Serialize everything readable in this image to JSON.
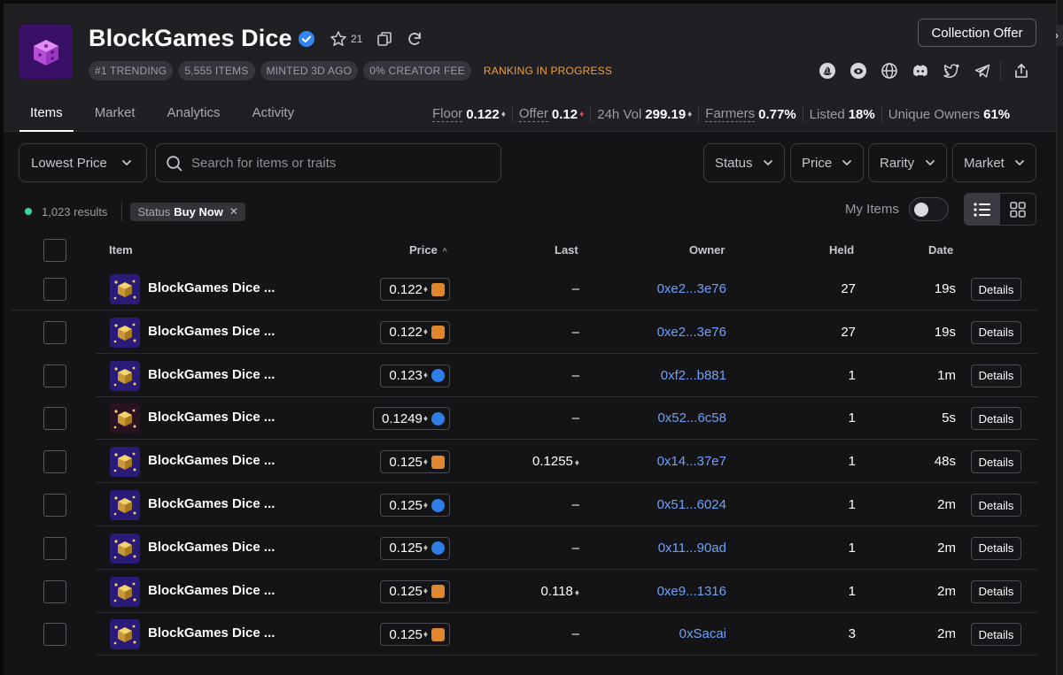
{
  "collection": {
    "title": "BlockGames Dice",
    "watch_count": "21",
    "tags": [
      "#1 TRENDING",
      "5,555 ITEMS",
      "MINTED 3D AGO",
      "0% CREATOR FEE"
    ],
    "ranking": "RANKING IN PROGRESS",
    "offer_button": "Collection Offer"
  },
  "tabs": [
    {
      "label": "Items",
      "active": true
    },
    {
      "label": "Market",
      "active": false
    },
    {
      "label": "Analytics",
      "active": false
    },
    {
      "label": "Activity",
      "active": false
    }
  ],
  "stats": {
    "floor_label": "Floor",
    "floor_value": "0.122",
    "offer_label": "Offer",
    "offer_value": "0.12",
    "vol_label": "24h Vol",
    "vol_value": "299.19",
    "farmers_label": "Farmers",
    "farmers_value": "0.77%",
    "listed_label": "Listed",
    "listed_value": "18%",
    "owners_label": "Unique Owners",
    "owners_value": "61%"
  },
  "toolbar": {
    "sort_label": "Lowest Price",
    "search_placeholder": "Search for items or traits",
    "filters": [
      "Status",
      "Price",
      "Rarity",
      "Market"
    ]
  },
  "results": {
    "count": "1,023 results",
    "chip_label": "Status",
    "chip_value": "Buy Now",
    "my_items_label": "My Items"
  },
  "table": {
    "headers": {
      "item": "Item",
      "price": "Price",
      "last": "Last",
      "owner": "Owner",
      "held": "Held",
      "date": "Date"
    },
    "details_label": "Details",
    "rows": [
      {
        "name": "BlockGames Dice ...",
        "price": "0.122",
        "market": "blur",
        "last": "–",
        "owner": "0xe2...3e76",
        "held": "27",
        "date": "19s"
      },
      {
        "name": "BlockGames Dice ...",
        "price": "0.122",
        "market": "blur",
        "last": "–",
        "owner": "0xe2...3e76",
        "held": "27",
        "date": "19s"
      },
      {
        "name": "BlockGames Dice ...",
        "price": "0.123",
        "market": "opensea",
        "last": "–",
        "owner": "0xf2...b881",
        "held": "1",
        "date": "1m"
      },
      {
        "name": "BlockGames Dice ...",
        "price": "0.1249",
        "market": "opensea",
        "last": "–",
        "owner": "0x52...6c58",
        "held": "1",
        "date": "5s"
      },
      {
        "name": "BlockGames Dice ...",
        "price": "0.125",
        "market": "blur",
        "last": "0.1255",
        "owner": "0x14...37e7",
        "held": "1",
        "date": "48s"
      },
      {
        "name": "BlockGames Dice ...",
        "price": "0.125",
        "market": "opensea",
        "last": "–",
        "owner": "0x51...6024",
        "held": "1",
        "date": "2m"
      },
      {
        "name": "BlockGames Dice ...",
        "price": "0.125",
        "market": "opensea",
        "last": "–",
        "owner": "0x11...90ad",
        "held": "1",
        "date": "2m"
      },
      {
        "name": "BlockGames Dice ...",
        "price": "0.125",
        "market": "blur",
        "last": "0.118",
        "owner": "0xe9...1316",
        "held": "1",
        "date": "2m"
      },
      {
        "name": "BlockGames Dice ...",
        "price": "0.125",
        "market": "blur",
        "last": "–",
        "owner": "0xSacai",
        "held": "3",
        "date": "2m"
      }
    ]
  },
  "colors": {
    "background": "#141416",
    "header": "#1f1f24",
    "accent_link": "#6ea0f7",
    "ranking": "#f2a03a",
    "status_dot": "#3ad4a0"
  }
}
